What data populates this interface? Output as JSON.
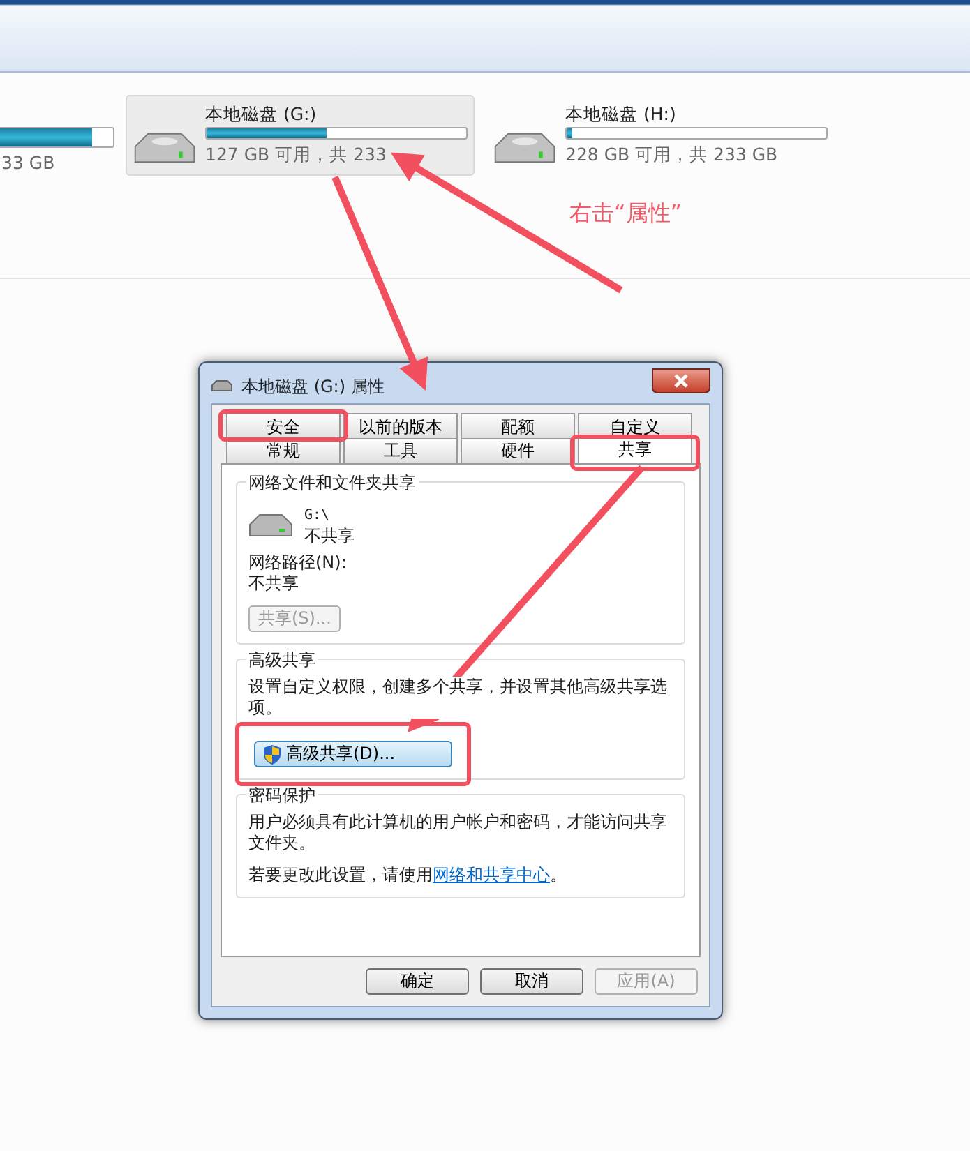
{
  "explorer": {
    "drives": [
      {
        "kind": "partial",
        "usage": "33 GB",
        "level": 0.82,
        "selected": false
      },
      {
        "name": "本地磁盘 (G:)",
        "usage": "127 GB 可用，共 233",
        "level": 0.46,
        "selected": true
      },
      {
        "name": "本地磁盘 (H:)",
        "usage": "228 GB 可用，共 233 GB",
        "level": 0.02,
        "selected": false
      }
    ]
  },
  "annotation": {
    "label": "右击“属性”"
  },
  "dialog": {
    "title": "本地磁盘 (G:) 属性",
    "tab_rows": [
      [
        {
          "label": "安全",
          "selected": false,
          "highlighted": true
        },
        {
          "label": "以前的版本",
          "selected": false,
          "highlighted": false
        },
        {
          "label": "配额",
          "selected": false,
          "highlighted": false
        },
        {
          "label": "自定义",
          "selected": false,
          "highlighted": false
        }
      ],
      [
        {
          "label": "常规",
          "selected": false,
          "highlighted": false
        },
        {
          "label": "工具",
          "selected": false,
          "highlighted": false
        },
        {
          "label": "硬件",
          "selected": false,
          "highlighted": false
        },
        {
          "label": "共享",
          "selected": true,
          "highlighted": true
        }
      ]
    ],
    "network_sharing": {
      "title": "网络文件和文件夹共享",
      "path": "G:\\",
      "status": "不共享",
      "network_path_label": "网络路径(N):",
      "network_path": "不共享",
      "button": {
        "label": "共享(S)...",
        "disabled": true
      }
    },
    "advanced_sharing": {
      "title": "高级共享",
      "description": "设置自定义权限，创建多个共享，并设置其他高级共享选项。",
      "button": {
        "label": "高级共享(D)...",
        "disabled": false,
        "highlighted": true
      }
    },
    "password_protection": {
      "title": "密码保护",
      "description": "用户必须具有此计算机的用户帐户和密码，才能访问共享文件夹。",
      "hint": "若要更改此设置，请使用",
      "link": "网络和共享中心",
      "hint_end": "。"
    },
    "buttons": [
      {
        "label": "确定",
        "disabled": false
      },
      {
        "label": "取消",
        "disabled": false
      },
      {
        "label": "应用(A)",
        "disabled": true
      }
    ]
  }
}
